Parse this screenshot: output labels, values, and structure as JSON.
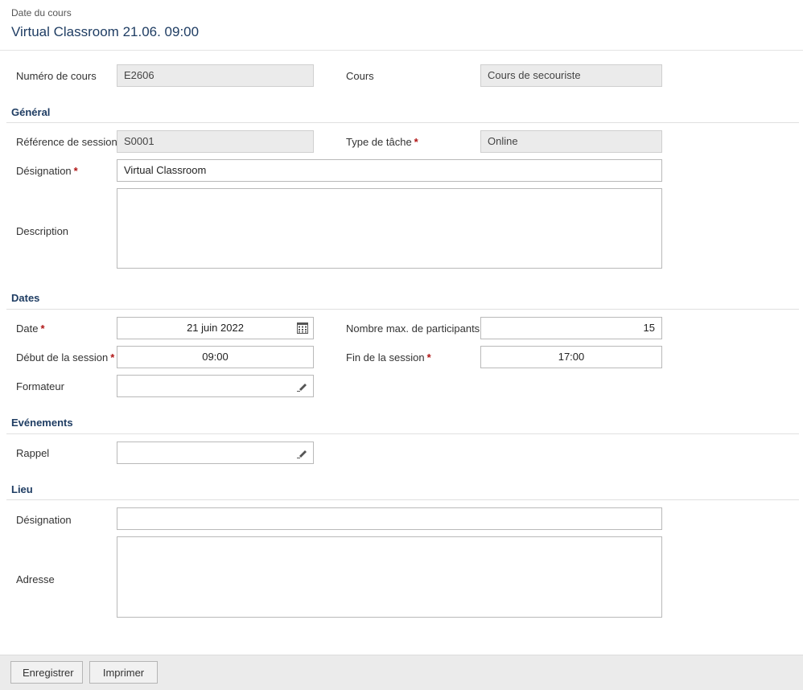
{
  "header": {
    "supertitle": "Date du cours",
    "title": "Virtual Classroom 21.06. 09:00"
  },
  "course": {
    "number_label": "Numéro de cours",
    "number_value": "E2606",
    "course_label": "Cours",
    "course_value": "Cours de secouriste"
  },
  "general": {
    "section_title": "Général",
    "session_ref_label": "Référence de session",
    "session_ref_value": "S0001",
    "task_type_label": "Type de tâche",
    "task_type_value": "Online",
    "designation_label": "Désignation",
    "designation_value": "Virtual Classroom",
    "description_label": "Description",
    "description_value": ""
  },
  "dates": {
    "section_title": "Dates",
    "date_label": "Date",
    "date_value": "21 juin 2022",
    "max_participants_label": "Nombre max. de participants",
    "max_participants_value": "15",
    "start_label": "Début de la session",
    "start_value": "09:00",
    "end_label": "Fin de la session",
    "end_value": "17:00",
    "trainer_label": "Formateur",
    "trainer_value": ""
  },
  "events": {
    "section_title": "Evénements",
    "reminder_label": "Rappel",
    "reminder_value": ""
  },
  "location": {
    "section_title": "Lieu",
    "designation_label": "Désignation",
    "designation_value": "",
    "address_label": "Adresse",
    "address_value": ""
  },
  "required_marker": "*",
  "footer": {
    "save_label": "Enregistrer",
    "print_label": "Imprimer"
  },
  "icons": {
    "calendar": "calendar-icon",
    "edit": "pencil-icon"
  },
  "colors": {
    "title": "#1f3d63",
    "required": "#b01515",
    "readonly_bg": "#ebebeb"
  }
}
